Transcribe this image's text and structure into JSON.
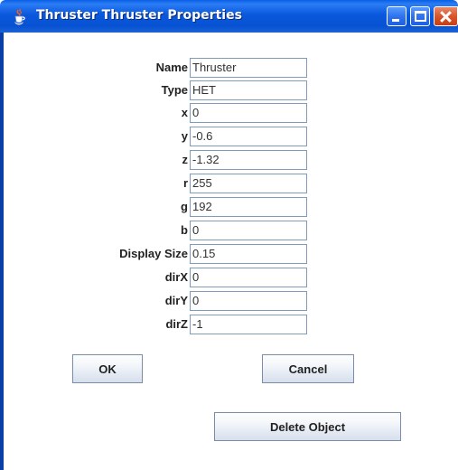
{
  "window": {
    "title": "Thruster Thruster Properties",
    "icon": "java-cup-icon",
    "controls": [
      "minimize-icon",
      "maximize-icon",
      "close-icon"
    ]
  },
  "form": {
    "fields": [
      {
        "label": "Name",
        "value": "Thruster"
      },
      {
        "label": "Type",
        "value": "HET"
      },
      {
        "label": "x",
        "value": "0"
      },
      {
        "label": "y",
        "value": "-0.6"
      },
      {
        "label": "z",
        "value": "-1.32"
      },
      {
        "label": "r",
        "value": "255"
      },
      {
        "label": "g",
        "value": "192"
      },
      {
        "label": "b",
        "value": "0"
      },
      {
        "label": "Display Size",
        "value": "0.15"
      },
      {
        "label": "dirX",
        "value": "0"
      },
      {
        "label": "dirY",
        "value": "0"
      },
      {
        "label": "dirZ",
        "value": "-1"
      }
    ]
  },
  "buttons": {
    "ok": "OK",
    "cancel": "Cancel",
    "delete": "Delete Object"
  },
  "colors": {
    "titlebar": "#0a58dc",
    "close_button": "#d9552c",
    "field_border": "#7f9db9"
  }
}
